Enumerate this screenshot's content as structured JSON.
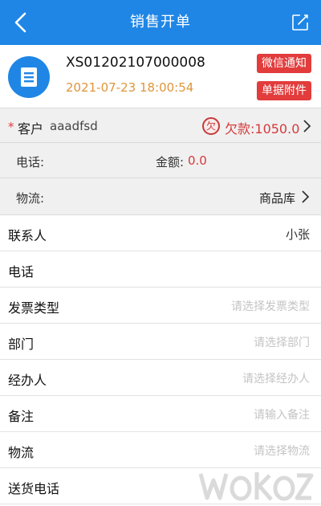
{
  "header": {
    "title": "销售开单"
  },
  "order": {
    "number": "XS01202107000008",
    "datetime": "2021-07-23 18:00:54",
    "wechat_notify_label": "微信通知",
    "attachment_label": "单据附件"
  },
  "customer": {
    "label": "客户",
    "value": "aaadfsd",
    "owe_badge": "欠",
    "owe_text": "欠款:1050.0"
  },
  "phone_amount": {
    "phone_label": "电话:",
    "amount_label": "金额:",
    "amount_value": "0.0"
  },
  "logistics": {
    "label": "物流:",
    "value": "商品库"
  },
  "form": {
    "contact": {
      "label": "联系人",
      "value": "小张"
    },
    "phone": {
      "label": "电话"
    },
    "invoice_type": {
      "label": "发票类型",
      "placeholder": "请选择发票类型"
    },
    "department": {
      "label": "部门",
      "placeholder": "请选择部门"
    },
    "handler": {
      "label": "经办人",
      "placeholder": "请选择经办人"
    },
    "remark": {
      "label": "备注",
      "placeholder": "请输入备注"
    },
    "logistics": {
      "label": "物流",
      "placeholder": "请选择物流"
    },
    "delivery_phone": {
      "label": "送货电话"
    }
  },
  "colors": {
    "brand_blue": "#1f86e6",
    "alert_red": "#e23c3c",
    "time_orange": "#e0953a"
  },
  "icons": {
    "back": "chevron-left-icon",
    "edit": "edit-icon",
    "order": "receipt-icon",
    "chevron": "chevron-right-icon"
  }
}
